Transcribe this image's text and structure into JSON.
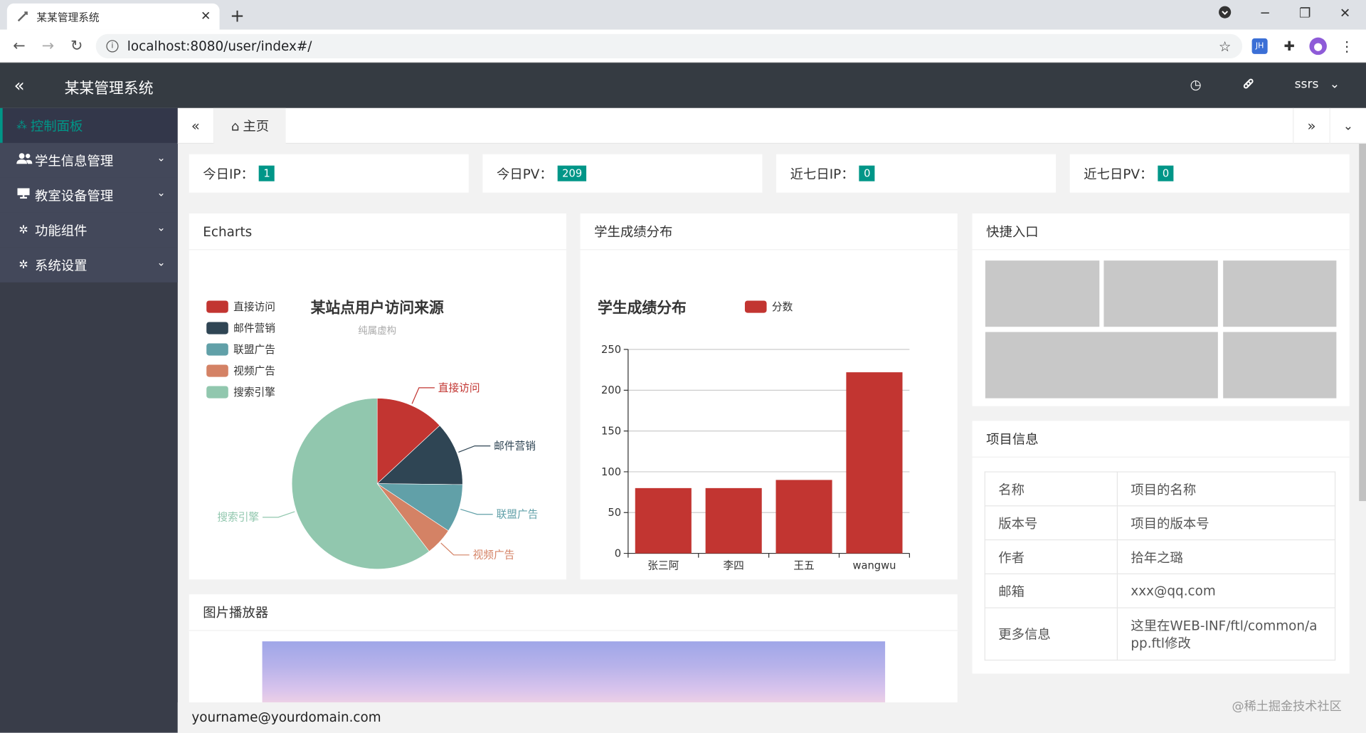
{
  "browser": {
    "tab_title": "某某管理系统",
    "url": "localhost:8080/user/index#/",
    "ext_jh": "JH"
  },
  "header": {
    "app_title": "某某管理系统",
    "user": "ssrs"
  },
  "sidebar": {
    "items": [
      {
        "label": "控制面板",
        "icon": "dashboard-icon"
      },
      {
        "label": "学生信息管理",
        "icon": "users-icon"
      },
      {
        "label": "教室设备管理",
        "icon": "monitor-icon"
      },
      {
        "label": "功能组件",
        "icon": "gear-icon"
      },
      {
        "label": "系统设置",
        "icon": "gear-icon"
      }
    ]
  },
  "tabs": {
    "home": "主页"
  },
  "stats": [
    {
      "label": "今日IP：",
      "value": "1"
    },
    {
      "label": "今日PV：",
      "value": "209"
    },
    {
      "label": "近七日IP：",
      "value": "0"
    },
    {
      "label": "近七日PV：",
      "value": "0"
    }
  ],
  "cards": {
    "echarts": "Echarts",
    "scores": "学生成绩分布",
    "quick": "快捷入口",
    "project": "项目信息",
    "player": "图片播放器"
  },
  "chart_data": [
    {
      "type": "pie",
      "title": "某站点用户访问来源",
      "subtitle": "纯属虚构",
      "legend_position": "top-left",
      "categories": [
        "直接访问",
        "邮件营销",
        "联盟广告",
        "视频广告",
        "搜索引擎"
      ],
      "values": [
        335,
        310,
        234,
        135,
        1548
      ],
      "colors": [
        "#c23531",
        "#2f4554",
        "#61a0a8",
        "#d48265",
        "#91c7ae"
      ]
    },
    {
      "type": "bar",
      "title": "学生成绩分布",
      "legend_position": "top",
      "categories": [
        "张三阿",
        "李四",
        "王五",
        "wangwu"
      ],
      "series": [
        {
          "name": "分数",
          "values": [
            80,
            80,
            90,
            222
          ]
        }
      ],
      "ylim": [
        0,
        250
      ],
      "yticks": [
        "0",
        "50",
        "100",
        "150",
        "200",
        "250"
      ],
      "color": "#c23531"
    }
  ],
  "project_info": [
    {
      "k": "名称",
      "v": "项目的名称"
    },
    {
      "k": "版本号",
      "v": "项目的版本号"
    },
    {
      "k": "作者",
      "v": "拾年之璐"
    },
    {
      "k": "邮箱",
      "v": "xxx@qq.com"
    },
    {
      "k": "更多信息",
      "v": "这里在WEB-INF/ftl/common/app.ftl修改"
    }
  ],
  "footer": {
    "email": "yourname@yourdomain.com"
  },
  "watermark": "@稀土掘金技术社区"
}
